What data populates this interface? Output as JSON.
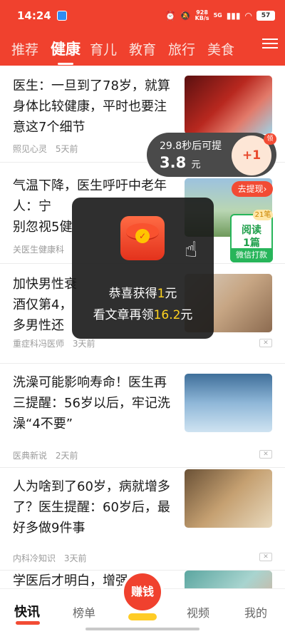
{
  "status_bar": {
    "time": "14:24",
    "net_speed": "928",
    "net_unit": "KB/s",
    "signal": "5G",
    "battery": "57"
  },
  "tabs": [
    "推荐",
    "健康",
    "育儿",
    "教育",
    "旅行",
    "美食"
  ],
  "active_tab": "健康",
  "articles": [
    {
      "title": "医生：一旦到了78岁，就算身体比较健康，平时也要注意这7个细节",
      "source": "照见心灵",
      "time": "5天前"
    },
    {
      "title": "气温下降，医生呼吁中老年人：宁",
      "title_2": "别忽视5健",
      "source": "关医生健康科",
      "time": ""
    },
    {
      "title": "加快男性衰",
      "title_2": "酒仅第4，",
      "title_3": "多男性还",
      "source": "重症科冯医师",
      "time": "3天前"
    },
    {
      "title": "洗澡可能影响寿命！医生再三提醒：56岁以后，牢记洗澡“4不要”",
      "source": "医典新说",
      "time": "2天前"
    },
    {
      "title": "人为啥到了60岁，病就增多了？医生提醒：60岁后，最好多做9件事",
      "source": "内科冷知识",
      "time": "3天前"
    },
    {
      "title": "学医后才明白，增强骨密",
      "source": "",
      "time": ""
    }
  ],
  "reward_timer": {
    "countdown_text": "29.8秒后可提",
    "amount": "3.8",
    "unit": "元",
    "plus": "+1",
    "badge": "领",
    "withdraw_label": "去提现",
    "withdraw_arrow": "›"
  },
  "read_task": {
    "badge": "21笔",
    "line1": "阅读",
    "line2": "1篇",
    "action": "微信打款"
  },
  "popup": {
    "line1_prefix": "恭喜获得",
    "line1_amount": "1",
    "line1_suffix": "元",
    "line2_prefix": "看文章再领",
    "line2_amount": "16.2",
    "line2_suffix": "元"
  },
  "bottom_nav": {
    "items": [
      "快讯",
      "榜单",
      "视频",
      "我的"
    ],
    "earn_label": "赚钱"
  },
  "colors": {
    "brand_red": "#f0412e",
    "accent_yellow": "#ffd21f",
    "task_green": "#27b55a"
  }
}
